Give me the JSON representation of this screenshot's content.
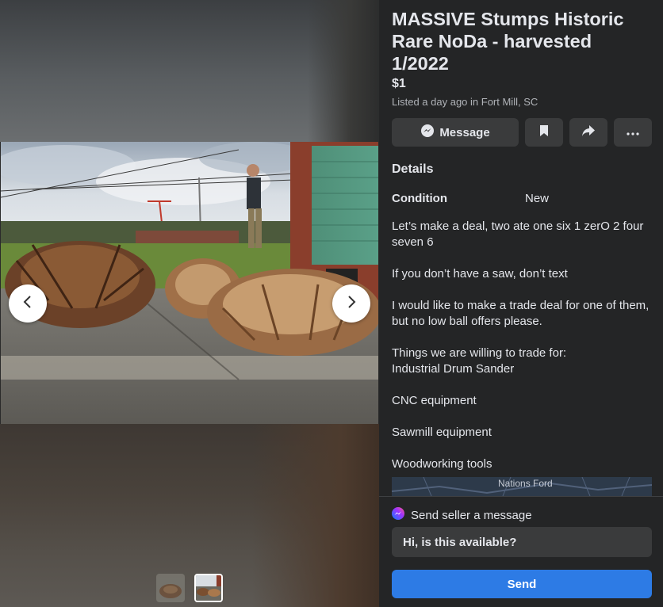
{
  "listing": {
    "title": "MASSIVE Stumps Historic Rare NoDa - harvested 1/2022",
    "price": "$1",
    "listed": "Listed a day ago in Fort Mill, SC"
  },
  "actions": {
    "message_label": "Message",
    "message_icon": "messenger-icon",
    "save_icon": "bookmark-icon",
    "share_icon": "share-arrow-icon",
    "more_icon": "more-dots-icon"
  },
  "details": {
    "heading": "Details",
    "condition_label": "Condition",
    "condition_value": "New",
    "description": {
      "p1a": "Let’s make a deal, two ate one six 1 zerO 2 four",
      "p1b": "seven 6",
      "p2": "If you don’t have a saw, don’t text",
      "p3a": "I would like to make a trade deal for one of them,",
      "p3b": "but no low ball offers please.",
      "p4a": "Things we are willing to trade for:",
      "p4b": "Industrial Drum Sander",
      "p5": "CNC equipment",
      "p6": "Sawmill equipment",
      "p7": "Woodworking tools"
    }
  },
  "map": {
    "label": "Nations Ford"
  },
  "message_box": {
    "heading": "Send seller a message",
    "input_value": "Hi, is this available?",
    "send_label": "Send"
  },
  "gallery": {
    "prev_icon": "chevron-left-icon",
    "next_icon": "chevron-right-icon",
    "thumb_count": 2,
    "selected_index": 2
  },
  "colors": {
    "panel_bg": "#242526",
    "button_bg": "#3a3b3c",
    "accent": "#2d7be5",
    "text_primary": "#e4e6eb",
    "text_secondary": "#b0b3b8"
  }
}
